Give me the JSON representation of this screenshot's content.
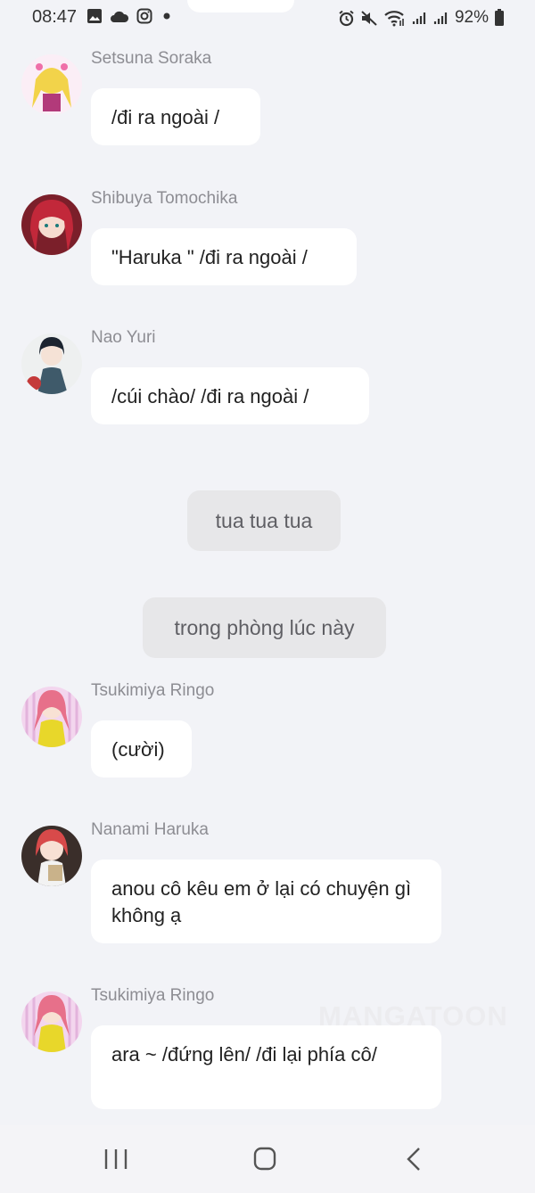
{
  "status_bar": {
    "time": "08:47",
    "battery": "92%",
    "left_icons": [
      "image-icon",
      "cloud-icon",
      "instagram-icon",
      "dot-icon"
    ],
    "right_icons": [
      "alarm-icon",
      "mute-icon",
      "wifi-icon",
      "signal-icon",
      "signal-icon",
      "battery-icon"
    ]
  },
  "messages": [
    {
      "sender": "Setsuna Soraka",
      "text": "/đi ra ngoài /"
    },
    {
      "sender": "Shibuya Tomochika",
      "text": "\"Haruka \" /đi ra ngoài /"
    },
    {
      "sender": "Nao Yuri",
      "text": "/cúi chào/ /đi ra ngoài /"
    },
    {
      "sender": "Tsukimiya Ringo",
      "text": "(cười)"
    },
    {
      "sender": "Nanami Haruka",
      "text": "anou cô kêu em ở lại có chuyện gì không ạ"
    },
    {
      "sender": "Tsukimiya Ringo",
      "text": "ara ~ /đứng lên/ /đi lại phía cô/"
    }
  ],
  "narrations": [
    "tua tua tua",
    "trong phòng lúc này"
  ],
  "watermark": "MANGATOON",
  "colors": {
    "background": "#f2f3f7",
    "bubble": "#ffffff",
    "narration": "#e7e7e9",
    "sender": "#8d8d93"
  },
  "nav_bar": [
    "recents-icon",
    "home-icon",
    "back-icon"
  ]
}
